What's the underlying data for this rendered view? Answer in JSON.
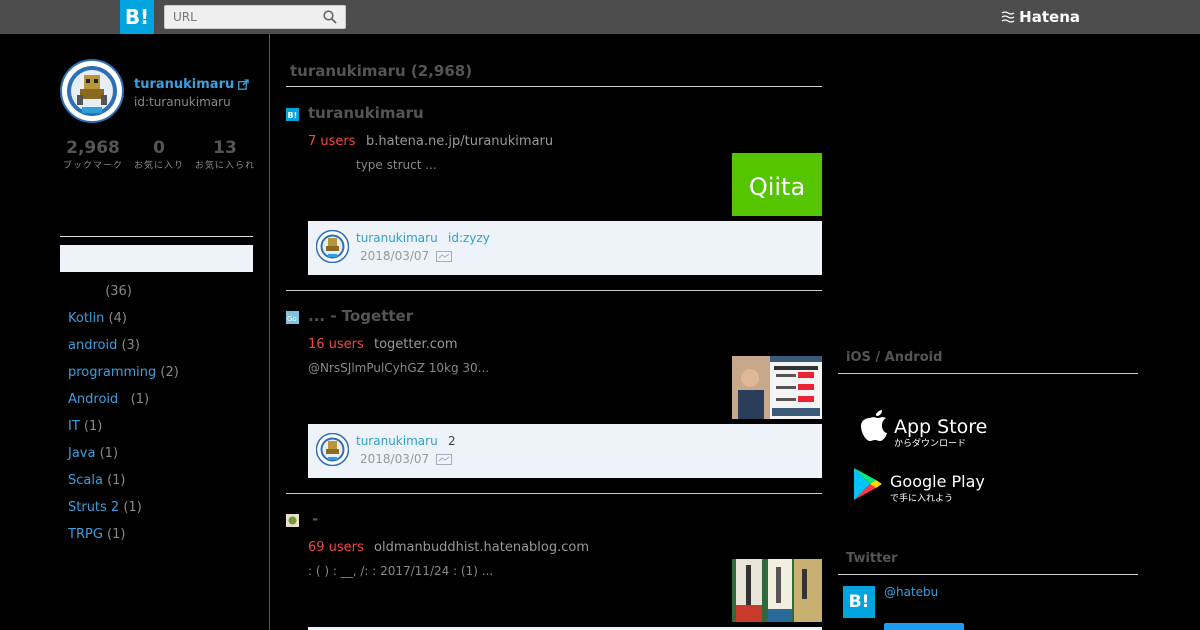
{
  "header": {
    "logo": "B!",
    "search_placeholder": "URL",
    "brand": "Hatena"
  },
  "profile": {
    "name": "turanukimaru",
    "id": "id:turanukimaru",
    "stats": [
      {
        "num": "2,968",
        "label": "ブックマーク"
      },
      {
        "num": "0",
        "label": "お気に入り"
      },
      {
        "num": "13",
        "label": "お気に入られ"
      }
    ]
  },
  "tags": [
    {
      "name": "",
      "count": "(36)"
    },
    {
      "name": "Kotlin",
      "count": "(4)"
    },
    {
      "name": "android",
      "count": "(3)"
    },
    {
      "name": "programming",
      "count": "(2)"
    },
    {
      "name": "Android",
      "count": "(1)"
    },
    {
      "name": "IT",
      "count": "(1)"
    },
    {
      "name": "Java",
      "count": "(1)"
    },
    {
      "name": "Scala",
      "count": "(1)"
    },
    {
      "name": "Struts 2",
      "count": "(1)"
    },
    {
      "name": "TRPG",
      "count": "(1)"
    }
  ],
  "main": {
    "title": "turanukimaru (2,968)",
    "entries": [
      {
        "title": "turanukimaru",
        "users": "7 users",
        "domain": "b.hatena.ne.jp/turanukimaru",
        "desc": "type  struct               ...",
        "comment_user": "turanukimaru",
        "comment_text": "id:zyzy",
        "comment_date": "2018/03/07"
      },
      {
        "title": "... - Togetter",
        "users": "16 users",
        "domain": "togetter.com",
        "desc": "@NrsSJlmPulCyhGZ 10kg    30...",
        "comment_user": "turanukimaru",
        "comment_text": "2",
        "comment_date": "2018/03/07"
      },
      {
        "title": "-",
        "users": "69 users",
        "domain": "oldmanbuddhist.hatenablog.com",
        "desc": ":          (  ) :      __, /:  : 2017/11/24   :   (1)  ..."
      }
    ],
    "thumb_labels": {
      "qiita": "Qiita"
    }
  },
  "right": {
    "apps_title": "iOS / Android",
    "appstore_main": "App Store",
    "appstore_sub": "からダウンロード",
    "googleplay_main": "Google Play",
    "googleplay_sub": "で手に入れよう",
    "twitter_title": "Twitter",
    "twitter_logo": "B!",
    "twitter_handle": "@hatebu"
  },
  "colors": {
    "accent": "#00a4de",
    "link": "#3aa0e0",
    "users": "#f54545",
    "comment_bg": "#eef3fa"
  }
}
